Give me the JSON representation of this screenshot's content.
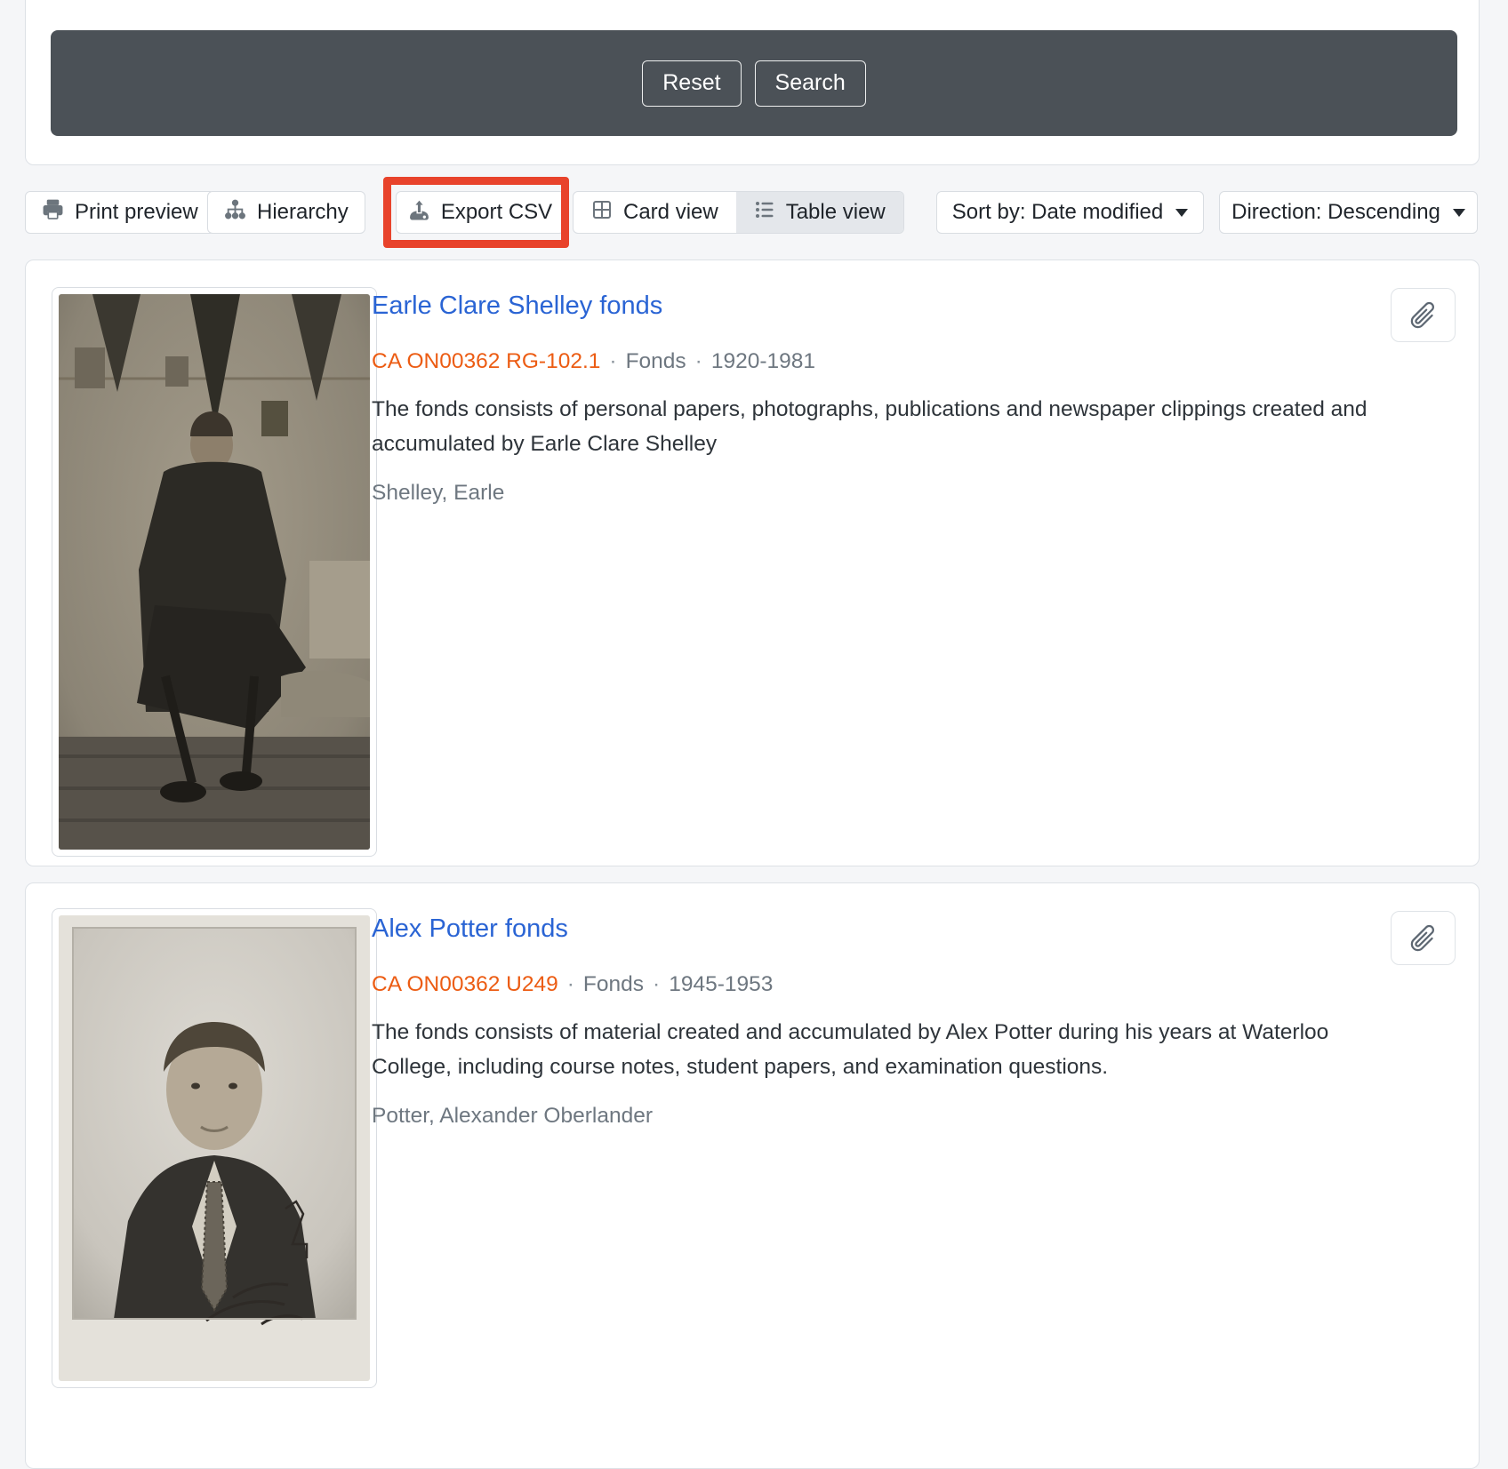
{
  "search_panel": {
    "reset_label": "Reset",
    "search_label": "Search"
  },
  "toolbar": {
    "print_preview_label": "Print preview",
    "hierarchy_label": "Hierarchy",
    "export_csv_label": "Export CSV",
    "card_view_label": "Card view",
    "table_view_label": "Table view",
    "sort_label": "Sort by: Date modified",
    "direction_label": "Direction: Descending"
  },
  "meta_separator": "·",
  "results": [
    {
      "title": "Earle Clare Shelley fonds",
      "reference_code": "CA ON00362 RG-102.1",
      "level": "Fonds",
      "dates": "1920-1981",
      "description": "The fonds consists of personal papers, photographs, publications and newspaper clippings created and accumulated by Earle Clare Shelley",
      "creator": "Shelley, Earle"
    },
    {
      "title": "Alex Potter fonds",
      "reference_code": "CA ON00362 U249",
      "level": "Fonds",
      "dates": "1945-1953",
      "description": "The fonds consists of material created and accumulated by Alex Potter during his years at Waterloo College, including course notes, student papers, and examination questions.",
      "creator": "Potter, Alexander Oberlander"
    }
  ],
  "colors": {
    "accent_blue": "#2a64d4",
    "accent_orange": "#ec5c13",
    "highlight_red": "#e8432b",
    "dark_bar": "#4b5157",
    "page_background": "#f5f6f8"
  }
}
